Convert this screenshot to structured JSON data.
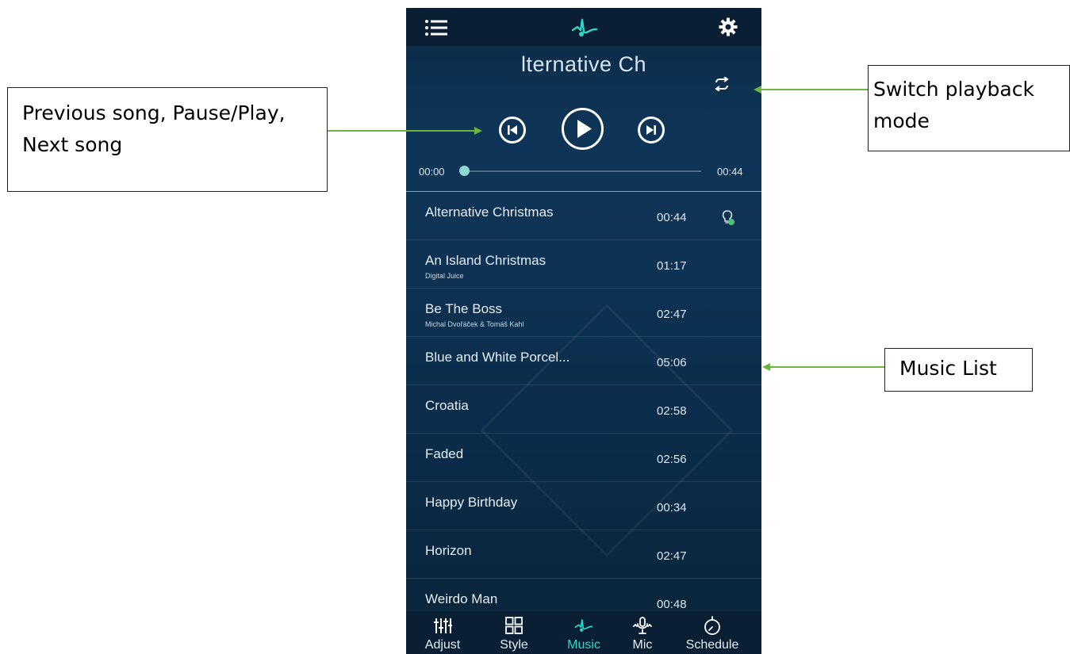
{
  "annotations": {
    "left": {
      "line1": "Previous song, Pause/Play,",
      "line2": "Next song"
    },
    "right_top": {
      "line1": "Switch playback",
      "line2": "mode"
    },
    "right_bottom": "Music List"
  },
  "colors": {
    "accent": "#2fd8c5",
    "arrow": "#6db33f",
    "background": "#0d3152"
  },
  "header": {
    "menu_icon": "menu-icon",
    "logo_icon": "music-note-logo-icon",
    "settings_icon": "gear-icon"
  },
  "player": {
    "now_playing": "lternative Ch",
    "mode_icon": "repeat-icon",
    "elapsed": "00:00",
    "total": "00:44",
    "progress": 0.0
  },
  "songs": [
    {
      "title": "Alternative Christmas",
      "artist": "",
      "duration": "00:44",
      "playing": true
    },
    {
      "title": "An Island Christmas",
      "artist": "Digital Juice",
      "duration": "01:17"
    },
    {
      "title": "Be The Boss",
      "artist": "Michal Dvořáček & Tomáš Kahl",
      "duration": "02:47"
    },
    {
      "title": "Blue and White Porcel...",
      "artist": "",
      "duration": "05:06"
    },
    {
      "title": "Croatia",
      "artist": "",
      "duration": "02:58"
    },
    {
      "title": "Faded",
      "artist": "",
      "duration": "02:56"
    },
    {
      "title": "Happy Birthday",
      "artist": "",
      "duration": "00:34"
    },
    {
      "title": "Horizon",
      "artist": "",
      "duration": "02:47"
    },
    {
      "title": "Weirdo Man",
      "artist": "",
      "duration": "00:48"
    }
  ],
  "tabs": [
    {
      "label": "Adjust",
      "icon": "equalizer-icon"
    },
    {
      "label": "Style",
      "icon": "grid-icon"
    },
    {
      "label": "Music",
      "icon": "music-note-icon",
      "active": true
    },
    {
      "label": "Mic",
      "icon": "microphone-icon"
    },
    {
      "label": "Schedule",
      "icon": "timer-icon"
    }
  ]
}
